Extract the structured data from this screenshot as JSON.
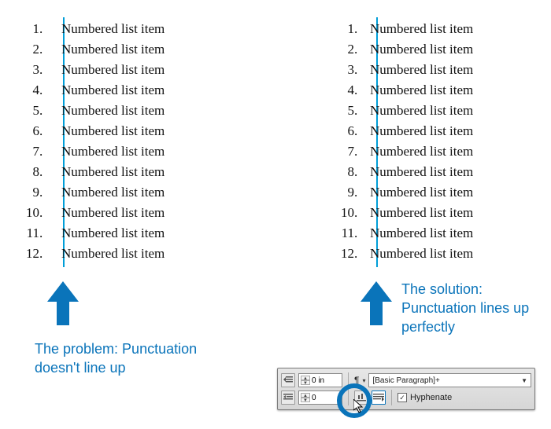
{
  "left_list": {
    "items": [
      {
        "n": "1",
        "t": "Numbered list item"
      },
      {
        "n": "2",
        "t": "Numbered list item"
      },
      {
        "n": "3",
        "t": "Numbered list item"
      },
      {
        "n": "4",
        "t": "Numbered list item"
      },
      {
        "n": "5",
        "t": "Numbered list item"
      },
      {
        "n": "6",
        "t": "Numbered list item"
      },
      {
        "n": "7",
        "t": "Numbered list item"
      },
      {
        "n": "8",
        "t": "Numbered list item"
      },
      {
        "n": "9",
        "t": "Numbered list item"
      },
      {
        "n": "10",
        "t": "Numbered list item"
      },
      {
        "n": "11",
        "t": "Numbered list item"
      },
      {
        "n": "12",
        "t": "Numbered list item"
      }
    ]
  },
  "right_list": {
    "items": [
      {
        "n": "1",
        "t": "Numbered list item"
      },
      {
        "n": "2",
        "t": "Numbered list item"
      },
      {
        "n": "3",
        "t": "Numbered list item"
      },
      {
        "n": "4",
        "t": "Numbered list item"
      },
      {
        "n": "5",
        "t": "Numbered list item"
      },
      {
        "n": "6",
        "t": "Numbered list item"
      },
      {
        "n": "7",
        "t": "Numbered list item"
      },
      {
        "n": "8",
        "t": "Numbered list item"
      },
      {
        "n": "9",
        "t": "Numbered list item"
      },
      {
        "n": "10",
        "t": "Numbered list item"
      },
      {
        "n": "11",
        "t": "Numbered list item"
      },
      {
        "n": "12",
        "t": "Numbered list item"
      }
    ]
  },
  "dot": ".",
  "arrow_color": "#0a74ba",
  "caption_left": "The problem: Punctuation doesn't line up",
  "caption_right": "The solution: Punctuation lines up perfectly",
  "panel": {
    "left_indent_value": "0 in",
    "first_line_value": "0",
    "style_name": "[Basic Paragraph]+",
    "hyphenate_label": "Hyphenate",
    "hyphenate_checked": "✓",
    "pilcrow": "¶"
  }
}
